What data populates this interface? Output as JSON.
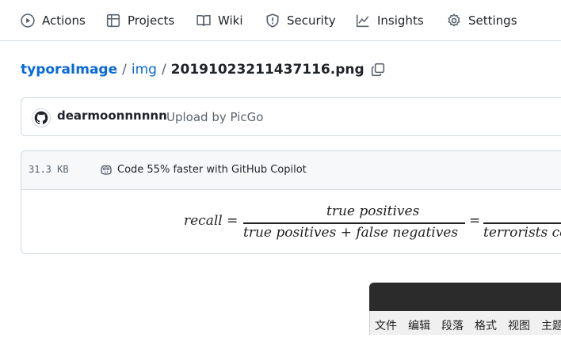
{
  "nav": {
    "actions": "Actions",
    "projects": "Projects",
    "wiki": "Wiki",
    "security": "Security",
    "insights": "Insights",
    "settings": "Settings"
  },
  "breadcrumb": {
    "repo": "typoraImage",
    "sep1": "/",
    "folder": "img",
    "sep2": "/",
    "file": "20191023211437116.png"
  },
  "commit": {
    "author": "dearmoonnnnnn",
    "message": "Upload by PicGo"
  },
  "file": {
    "size": "31.3 KB",
    "copilot": "Code 55% faster with GitHub Copilot"
  },
  "formula": {
    "lhs": "recall =",
    "num1": "true positives",
    "den1": "true positives  + false negatives",
    "eq": "=",
    "den2": "terrorists co"
  },
  "typora": {
    "menu": [
      "文件",
      "编辑",
      "段落",
      "格式",
      "视图",
      "主题"
    ]
  },
  "colors": {
    "link": "#0969da",
    "border": "#d1d9e0",
    "muted": "#59636e",
    "text": "#1f2328",
    "typora_title": "#2b2b2b"
  }
}
